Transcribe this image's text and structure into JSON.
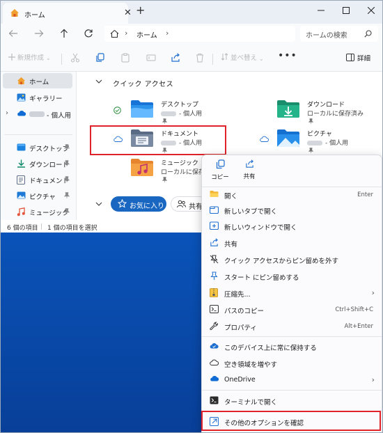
{
  "tab": {
    "title": "ホーム"
  },
  "address": {
    "crumb": "ホーム"
  },
  "search": {
    "placeholder": "ホームの検索"
  },
  "commandbar": {
    "new_label": "新規作成",
    "sort_label": "並べ替え",
    "more": "•••",
    "details_label": "詳細"
  },
  "sidebar": {
    "top": [
      {
        "label": "ホーム",
        "icon": "home-icon"
      },
      {
        "label": "ギャラリー",
        "icon": "gallery-icon"
      },
      {
        "label": "- 個人用",
        "icon": "onedrive-icon"
      }
    ],
    "pinned": [
      {
        "label": "デスクトップ",
        "icon": "desktop-folder-icon"
      },
      {
        "label": "ダウンロード",
        "icon": "download-folder-icon"
      },
      {
        "label": "ドキュメント",
        "icon": "documents-folder-icon"
      },
      {
        "label": "ピクチャ",
        "icon": "pictures-folder-icon"
      },
      {
        "label": "ミュージック",
        "icon": "music-folder-icon"
      }
    ]
  },
  "quick_access": {
    "title": "クイック アクセス",
    "folders": [
      {
        "name": "デスクトップ",
        "sub": "- 個人用",
        "status": "synced"
      },
      {
        "name": "ダウンロード",
        "sub": "ローカルに保存済み",
        "status": "none"
      },
      {
        "name": "ドキュメント",
        "sub": "- 個人用",
        "status": "cloud"
      },
      {
        "name": "ピクチャ",
        "sub": "- 個人用",
        "status": "cloud"
      },
      {
        "name": "ミュージック",
        "sub": "ローカルに保存済み",
        "status": "none"
      }
    ]
  },
  "filters": {
    "favorites": "お気に入り",
    "shared": "共有"
  },
  "status": {
    "count": "6 個の項目",
    "selected": "1 個の項目を選択"
  },
  "context_menu": {
    "quick": [
      {
        "label": "コピー",
        "icon": "copy-icon"
      },
      {
        "label": "共有",
        "icon": "share-icon"
      }
    ],
    "items": [
      {
        "label": "開く",
        "key": "Enter",
        "icon": "folder-open-icon"
      },
      {
        "label": "新しいタブで開く",
        "key": "",
        "icon": "new-tab-icon"
      },
      {
        "label": "新しいウィンドウで開く",
        "key": "",
        "icon": "new-window-icon"
      },
      {
        "label": "共有",
        "key": "",
        "icon": "share-icon"
      },
      {
        "label": "クイック アクセスからピン留めを外す",
        "key": "",
        "icon": "unpin-icon"
      },
      {
        "label": "スタート にピン留めする",
        "key": "",
        "icon": "pin-start-icon"
      },
      {
        "label": "圧縮先...",
        "key": "",
        "icon": "zip-icon"
      },
      {
        "label": "パスのコピー",
        "key": "Ctrl+Shift+C",
        "icon": "copy-path-icon"
      },
      {
        "label": "プロパティ",
        "key": "Alt+Enter",
        "icon": "wrench-icon"
      },
      {
        "label": "このデバイス上に常に保持する",
        "key": "",
        "icon": "keep-device-icon"
      },
      {
        "label": "空き領域を増やす",
        "key": "",
        "icon": "cloud-icon"
      },
      {
        "label": "OneDrive",
        "key": "",
        "icon": "onedrive-icon"
      },
      {
        "label": "ターミナルで開く",
        "key": "",
        "icon": "terminal-icon"
      },
      {
        "label": "その他のオプションを確認",
        "key": "",
        "icon": "more-options-icon"
      }
    ]
  }
}
